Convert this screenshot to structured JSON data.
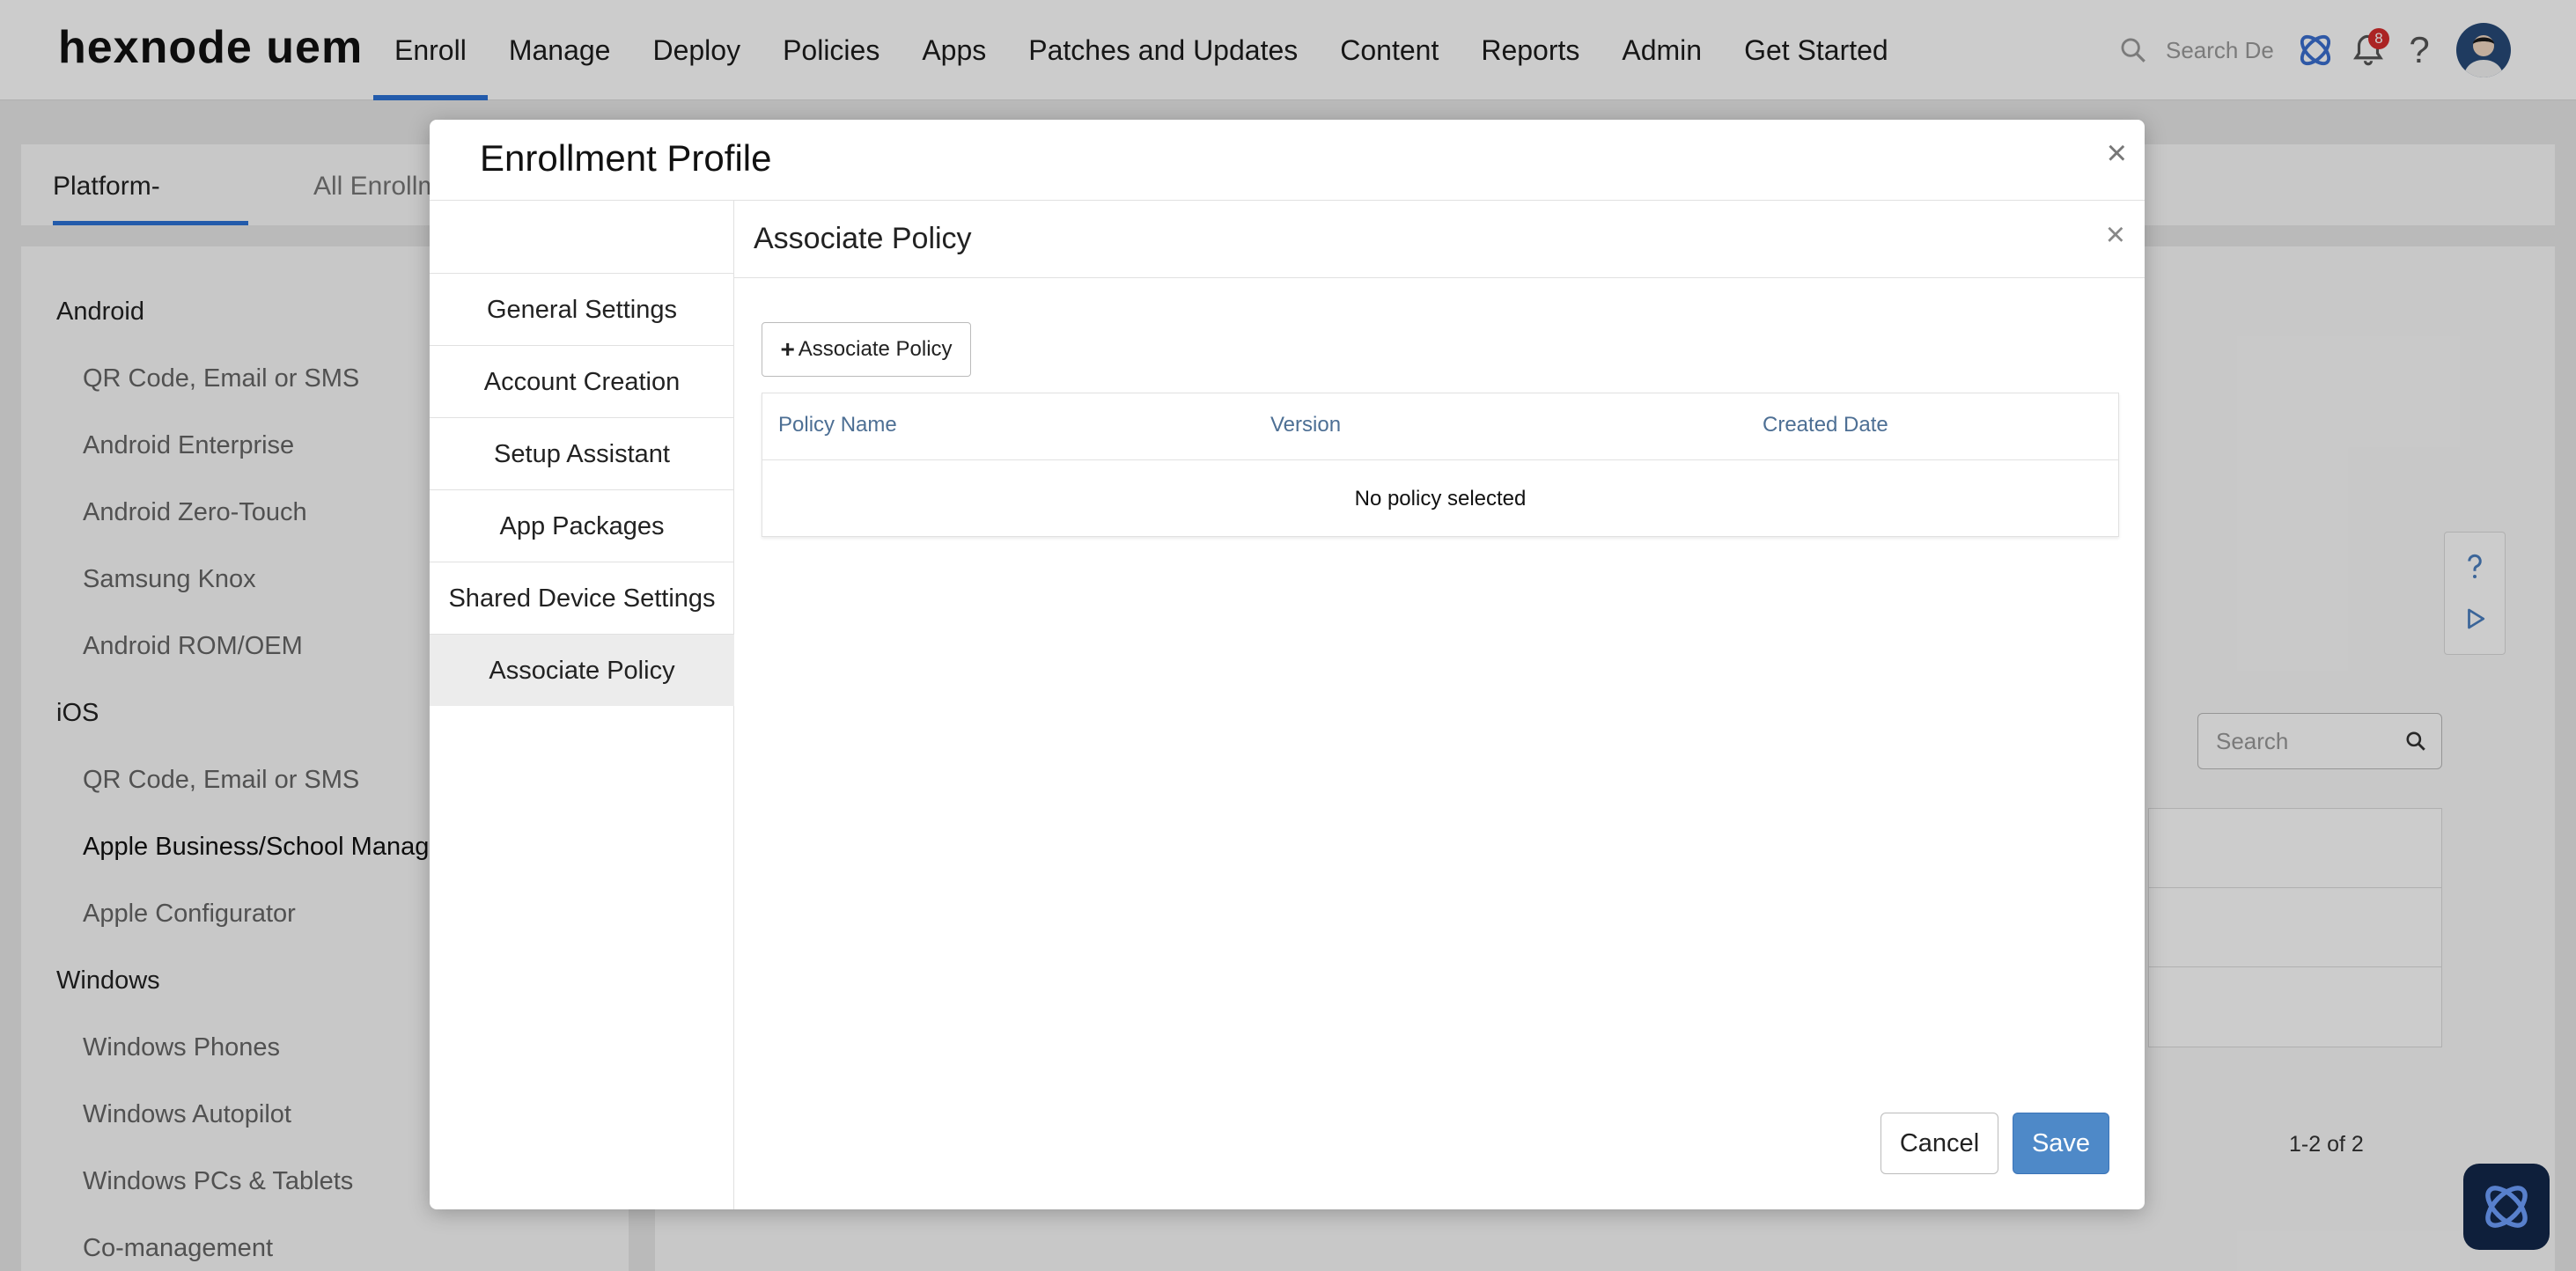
{
  "brand": {
    "logo_text": "hexnode uem",
    "accent": "#2c72d6",
    "primary_button": "#4e89c8"
  },
  "topnav": {
    "items": [
      {
        "label": "Enroll",
        "active": true
      },
      {
        "label": "Manage"
      },
      {
        "label": "Deploy"
      },
      {
        "label": "Policies"
      },
      {
        "label": "Apps"
      },
      {
        "label": "Patches and Updates"
      },
      {
        "label": "Content"
      },
      {
        "label": "Reports"
      },
      {
        "label": "Admin"
      },
      {
        "label": "Get Started"
      }
    ],
    "search_placeholder": "Search De",
    "notifications_count": "8"
  },
  "page": {
    "tabs": [
      {
        "label": "Platform-Specific",
        "active": true
      },
      {
        "label": "All Enrollm"
      }
    ],
    "sidebar": {
      "android": "Android",
      "android_items": [
        "QR Code, Email or SMS",
        "Android Enterprise",
        "Android Zero-Touch",
        "Samsung Knox",
        "Android ROM/OEM"
      ],
      "ios": "iOS",
      "ios_items": [
        "QR Code, Email or SMS",
        "Apple Business/School Manager",
        "Apple Configurator"
      ],
      "windows": "Windows",
      "windows_items": [
        "Windows Phones",
        "Windows Autopilot",
        "Windows PCs & Tablets",
        "Co-management"
      ]
    },
    "search_placeholder": "Search",
    "pagination": "1-2 of 2"
  },
  "modal": {
    "title": "Enrollment Profile",
    "nav_items": [
      {
        "label": "General Settings"
      },
      {
        "label": "Account Creation"
      },
      {
        "label": "Setup Assistant"
      },
      {
        "label": "App Packages"
      },
      {
        "label": "Shared Device Settings"
      },
      {
        "label": "Associate Policy",
        "active": true
      }
    ],
    "pane_title": "Associate Policy",
    "associate_button": "Associate Policy",
    "table": {
      "columns": [
        "Policy Name",
        "Version",
        "Created Date"
      ],
      "empty_text": "No policy selected"
    },
    "cancel_label": "Cancel",
    "save_label": "Save"
  }
}
